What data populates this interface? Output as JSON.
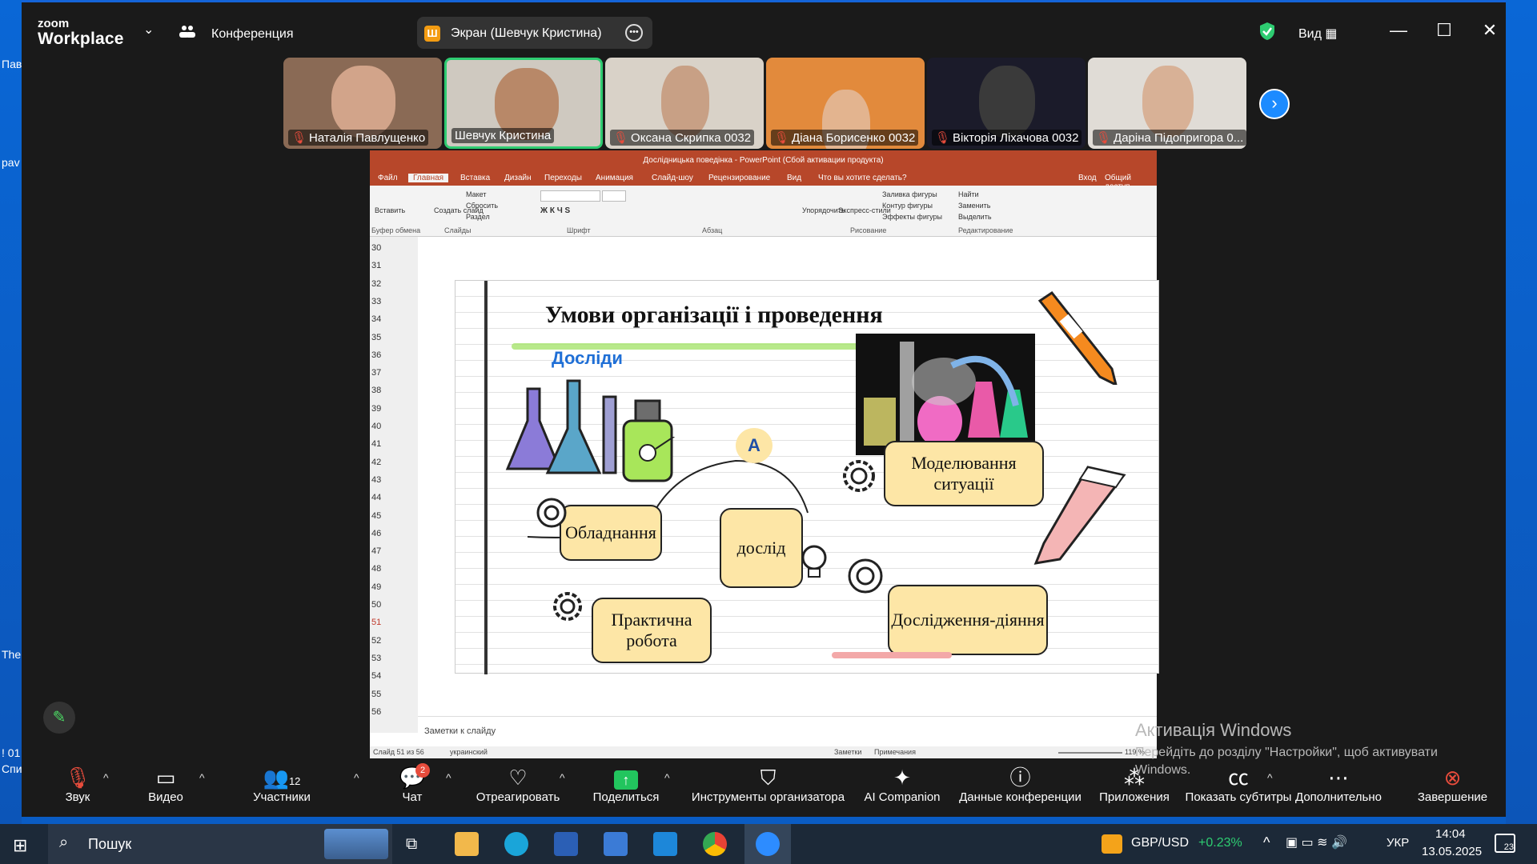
{
  "zoom": {
    "brand_top": "zoom",
    "brand_bottom": "Workplace",
    "conference": "Конференция",
    "share_label": "Экран (Шевчук Кристина)",
    "view": "Вид",
    "participants": [
      {
        "name": "Наталія Павлущенко",
        "muted": true
      },
      {
        "name": "Шевчук Кристина",
        "muted": false,
        "active": true
      },
      {
        "name": "Оксана Скрипка 0032",
        "muted": true
      },
      {
        "name": "Діана Борисенко 0032",
        "muted": true
      },
      {
        "name": "Вікторія Ліхачова 0032",
        "muted": true
      },
      {
        "name": "Даріна Підопригора 0...",
        "muted": true
      }
    ],
    "toolbar": {
      "audio": "Звук",
      "video": "Видео",
      "participants": "Участники",
      "participants_count": "12",
      "chat": "Чат",
      "chat_badge": "2",
      "react": "Отреагировать",
      "share": "Поделиться",
      "host_tools": "Инструменты организатора",
      "ai": "AI Companion",
      "info": "Данные конференции",
      "apps": "Приложения",
      "captions": "Показать субтитры",
      "more": "Дополнительно",
      "end": "Завершение"
    }
  },
  "ppt": {
    "window_title": "Дослідницька поведінка - PowerPoint (Сбой активации продукта)",
    "tabs": [
      "Файл",
      "Главная",
      "Вставка",
      "Дизайн",
      "Переходы",
      "Анимация",
      "Слайд-шоу",
      "Рецензирование",
      "Вид",
      "Что вы хотите сделать?"
    ],
    "right_tabs": [
      "Вход",
      "Общий доступ"
    ],
    "ribbon_groups": [
      "Буфер обмена",
      "Слайды",
      "Шрифт",
      "Абзац",
      "Рисование",
      "Редактирование"
    ],
    "ribbon_items": {
      "paste": "Вставить",
      "new_slide": "Создать слайд",
      "layout": "Макет",
      "reset": "Сбросить",
      "section": "Раздел",
      "arrange": "Упорядочить",
      "styles": "Экспресс-стили",
      "fill": "Заливка фигуры",
      "outline": "Контур фигуры",
      "effects": "Эффекты фигуры",
      "find": "Найти",
      "replace": "Заменить",
      "select": "Выделить"
    },
    "slide_numbers": [
      "30",
      "31",
      "32",
      "33",
      "34",
      "35",
      "36",
      "37",
      "38",
      "39",
      "40",
      "41",
      "42",
      "43",
      "44",
      "45",
      "46",
      "47",
      "48",
      "49",
      "50",
      "51",
      "52",
      "53",
      "54",
      "55",
      "56"
    ],
    "current_slide": "51",
    "notes_placeholder": "Заметки к слайду",
    "status_left": "Слайд 51 из 56",
    "status_lang": "украинский",
    "status_notes": "Заметки",
    "status_comments": "Примечания",
    "zoom_level": "119 %",
    "slide": {
      "title": "Умови організації і проведення",
      "subtitle": "Досліди",
      "badge": "A",
      "cards": [
        "Обладнання",
        "дослід",
        "Практична робота",
        "Моделювання ситуації",
        "Дослідження-діяння"
      ]
    }
  },
  "activation": {
    "line1": "Активація Windows",
    "line2": "Перейдіть до розділу \"Настройки\", щоб активувати",
    "line3": "Windows."
  },
  "desktop_labels": [
    "Пав",
    "pav",
    "The",
    "! 01",
    "Спи"
  ],
  "taskbar": {
    "search": "Пошук",
    "ticker": "GBP/USD",
    "ticker_change": "+0.23%",
    "lang": "УКР",
    "time": "14:04",
    "date": "13.05.2025",
    "notif_count": "23"
  },
  "colors": {
    "zoom_bg": "#1a1a1a",
    "ppt_accent": "#b7472a",
    "card_fill": "#fde6a6",
    "active_border": "#2ecc71",
    "ticker_green": "#2ecc71"
  }
}
